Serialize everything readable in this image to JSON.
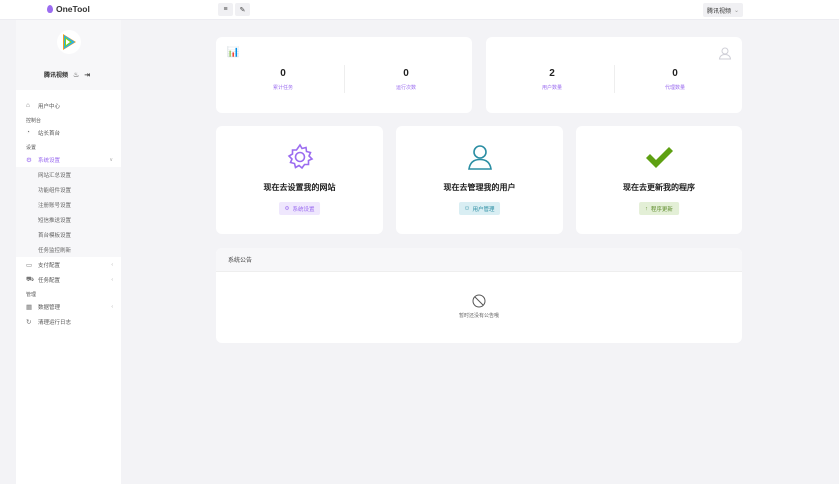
{
  "app": {
    "name": "OneTool"
  },
  "topbar": {
    "menu_icon": "≡",
    "brush_icon": "✎",
    "user": "腾讯视频",
    "caret": "⌄"
  },
  "profile": {
    "name": "腾讯视频"
  },
  "sidebar": {
    "user_center": "用户中心",
    "section_console": "控制台",
    "site_dashboard": "站长首台",
    "section_settings": "设置",
    "system_settings": "系统设置",
    "sub_items": [
      "网站汇总设置",
      "功能组件设置",
      "注册账号设置",
      "短信推送设置",
      "首台模板设置",
      "任务监控刷新"
    ],
    "payment_config": "支付配置",
    "task_config": "任务配置",
    "section_manage": "管理",
    "data_manage": "数据管理",
    "clear_cache": "清理运行日志"
  },
  "stats": [
    {
      "value": "0",
      "label": "累计任务"
    },
    {
      "value": "0",
      "label": "运行次数"
    },
    {
      "value": "2",
      "label": "用户数量"
    },
    {
      "value": "0",
      "label": "代理数量"
    }
  ],
  "actions": [
    {
      "title": "现在去设置我的网站",
      "button": "系统设置",
      "color": "#9b6cf0",
      "bg": "#efe7fd"
    },
    {
      "title": "现在去管理我的用户",
      "button": "用户管理",
      "color": "#2b8ea3",
      "bg": "#d9eef3"
    },
    {
      "title": "现在去更新我的程序",
      "button": "程序更新",
      "color": "#5e8c2c",
      "bg": "#e3efd6"
    }
  ],
  "notice": {
    "title": "系统公告",
    "empty_text": "暂时还没有公告哦"
  }
}
